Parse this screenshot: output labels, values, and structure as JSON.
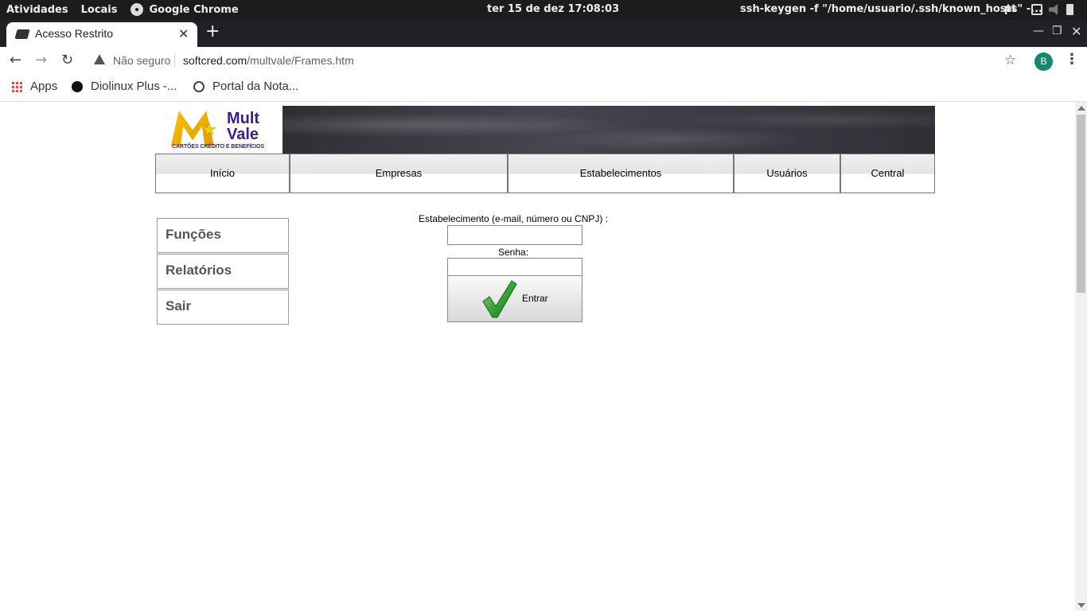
{
  "system_bar": {
    "activities": "Atividades",
    "places": "Locais",
    "app": "Google Chrome",
    "clock": "ter 15 de dez  17:08:03",
    "window_title": "ssh-keygen -f \"/home/usuario/.ssh/known_hosts\" -...",
    "lang": "pt"
  },
  "browser": {
    "tab_title": "Acesso Restrito",
    "security": "Não seguro",
    "url_host": "softcred.com",
    "url_path": "/multvale/Frames.htm",
    "profile_initial": "B"
  },
  "bookmarks": [
    {
      "label": "Apps"
    },
    {
      "label": "Diolinux Plus -..."
    },
    {
      "label": "Portal da Nota..."
    }
  ],
  "logo": {
    "name_line1": "Mult",
    "name_line2": "Vale",
    "tagline": "CARTÕES CRÉDITO E BENEFÍCIOS"
  },
  "nav": [
    {
      "label": "Início"
    },
    {
      "label": "Empresas"
    },
    {
      "label": "Estabelecimentos"
    },
    {
      "label": "Usuários"
    },
    {
      "label": "Central"
    }
  ],
  "side_menu": [
    {
      "label": "Funções"
    },
    {
      "label": "Relatórios"
    },
    {
      "label": "Sair"
    }
  ],
  "login": {
    "user_label": "Estabelecimento (e-mail, número ou CNPJ) :",
    "user_value": "",
    "password_label": "Senha:",
    "password_value": "",
    "submit_label": "Entrar"
  },
  "colors": {
    "brand_purple": "#3a1e8a",
    "brand_yellow": "#f5c400",
    "check_green": "#3aa53a"
  }
}
